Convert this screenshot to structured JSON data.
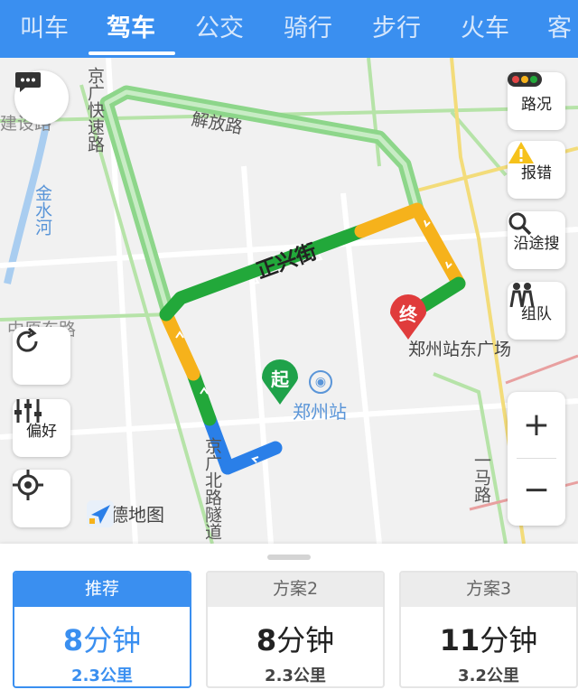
{
  "tabs": [
    {
      "label": "叫车",
      "active": false
    },
    {
      "label": "驾车",
      "active": true
    },
    {
      "label": "公交",
      "active": false
    },
    {
      "label": "骑行",
      "active": false
    },
    {
      "label": "步行",
      "active": false
    },
    {
      "label": "火车",
      "active": false
    },
    {
      "label": "客",
      "active": false
    }
  ],
  "map": {
    "road_labels": {
      "jiefang": "解放路",
      "zhengxing": "正兴街",
      "jingguang_kuaisu": "京广快速路",
      "jingguang_bei": "京广北路隧道",
      "jinshui": "金水河",
      "jian": "建设路",
      "zhongyuan": "中原东路",
      "yima": "一马路"
    },
    "poi": {
      "start_marker": "起",
      "end_marker": "终",
      "station": "郑州站",
      "destination": "郑州站东广场"
    },
    "logo": "高德地图",
    "controls": {
      "traffic": "路况",
      "report": "报错",
      "search_along": "沿途搜",
      "team": "组队",
      "preference": "偏好",
      "zoom_in": "+",
      "zoom_out": "−"
    }
  },
  "routes": [
    {
      "label": "推荐",
      "time_num": "8",
      "time_unit": "分钟",
      "distance": "2.3公里",
      "selected": true
    },
    {
      "label": "方案2",
      "time_num": "8",
      "time_unit": "分钟",
      "distance": "2.3公里",
      "selected": false
    },
    {
      "label": "方案3",
      "time_num": "11",
      "time_unit": "分钟",
      "distance": "3.2公里",
      "selected": false
    }
  ],
  "colors": {
    "accent": "#3a8ff0",
    "route_green": "#22a83a",
    "route_yellow": "#f6b21b",
    "route_blue": "#2a7fe8",
    "marker_start": "#1fa24a",
    "marker_end": "#e03c3c"
  }
}
